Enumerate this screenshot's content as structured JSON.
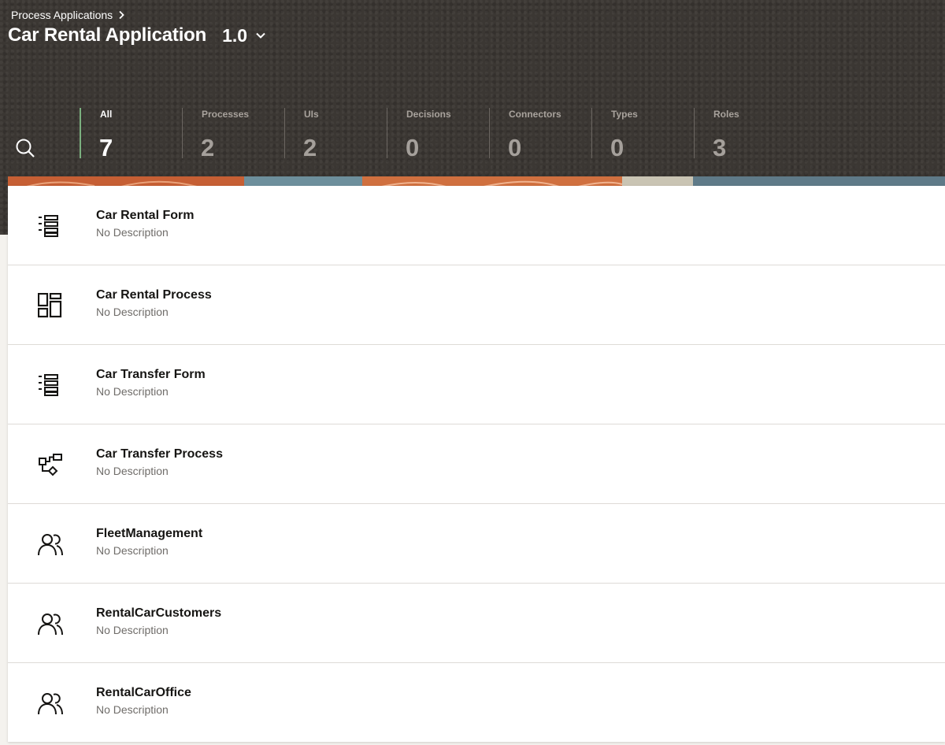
{
  "breadcrumb": {
    "label": "Process Applications"
  },
  "app": {
    "title": "Car Rental Application",
    "version": "1.0"
  },
  "tabs": [
    {
      "label": "All",
      "count": "7"
    },
    {
      "label": "Processes",
      "count": "2"
    },
    {
      "label": "UIs",
      "count": "2"
    },
    {
      "label": "Decisions",
      "count": "0"
    },
    {
      "label": "Connectors",
      "count": "0"
    },
    {
      "label": "Types",
      "count": "0"
    },
    {
      "label": "Roles",
      "count": "3"
    }
  ],
  "items": [
    {
      "name": "Car Rental Form",
      "description": "No Description",
      "icon": "form-icon"
    },
    {
      "name": "Car Rental Process",
      "description": "No Description",
      "icon": "dashboard-process-icon"
    },
    {
      "name": "Car Transfer Form",
      "description": "No Description",
      "icon": "form-icon"
    },
    {
      "name": "Car Transfer Process",
      "description": "No Description",
      "icon": "process-flow-icon"
    },
    {
      "name": "FleetManagement",
      "description": "No Description",
      "icon": "users-icon"
    },
    {
      "name": "RentalCarCustomers",
      "description": "No Description",
      "icon": "users-icon"
    },
    {
      "name": "RentalCarOffice",
      "description": "No Description",
      "icon": "users-icon"
    }
  ],
  "colors": {
    "header_bg": "#3b3733",
    "active_tab_accent": "#7bb07f"
  }
}
